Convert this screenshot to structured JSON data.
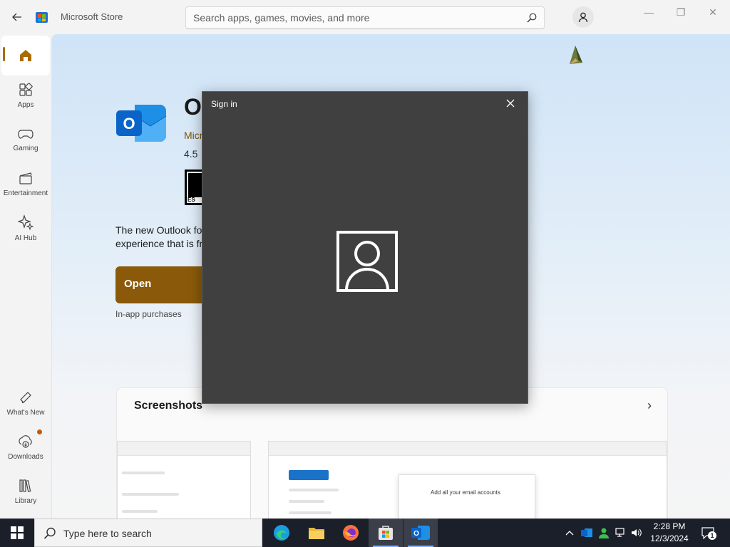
{
  "window": {
    "title": "Microsoft Store"
  },
  "search": {
    "placeholder": "Search apps, games, movies, and more"
  },
  "window_controls": {
    "minimize": "—",
    "maximize": "❐",
    "close": "✕"
  },
  "sidebar": {
    "items": [
      {
        "label": "",
        "icon": "home-icon",
        "active": true
      },
      {
        "label": "Apps",
        "icon": "apps-icon"
      },
      {
        "label": "Gaming",
        "icon": "gamepad-icon"
      },
      {
        "label": "Entertainment",
        "icon": "clapperboard-icon"
      },
      {
        "label": "AI Hub",
        "icon": "sparkle-icon"
      },
      {
        "label": "What's New",
        "icon": "megaphone-icon"
      },
      {
        "label": "Downloads",
        "icon": "download-icon"
      },
      {
        "label": "Library",
        "icon": "library-icon"
      }
    ]
  },
  "product": {
    "name": "O",
    "publisher": "Micr",
    "rating": "4.5",
    "esrb_text": "ES",
    "description_line1": "The new Outlook fo",
    "description_line2": "experience that is fr",
    "open_label": "Open",
    "in_app_purchases": "In-app purchases"
  },
  "screenshots": {
    "title": "Screenshots",
    "next": "›",
    "popup_text": "Add all your email accounts"
  },
  "dialog": {
    "title": "Sign in",
    "close": "✕"
  },
  "taskbar": {
    "search_text": "Type here to search",
    "apps": [
      "edge-icon",
      "file-explorer-icon",
      "firefox-icon",
      "store-icon",
      "outlook-icon"
    ],
    "time": "2:28 PM",
    "date": "12/3/2024",
    "notification_count": "1"
  },
  "colors": {
    "accent": "#8a5a0a",
    "dialog_bg": "#404040",
    "taskbar_bg": "#1a1f2a",
    "outlook_blue": "#0a64c8"
  }
}
